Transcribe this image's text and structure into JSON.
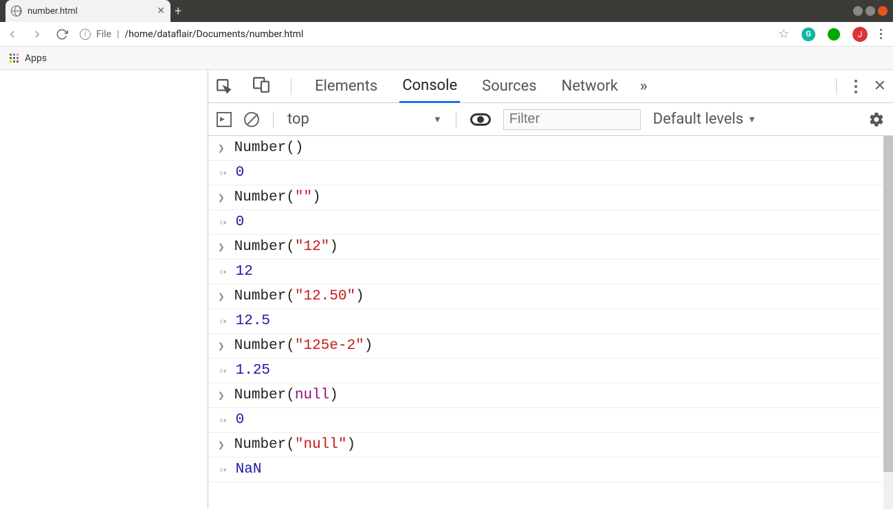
{
  "browser": {
    "tab_title": "number.html",
    "new_tab": "+",
    "addr_file_label": "File",
    "addr_path": "/home/dataflair/Documents/number.html",
    "apps_label": "Apps",
    "ext_g": "G",
    "ext_j": "J"
  },
  "devtools": {
    "tabs": {
      "elements": "Elements",
      "console": "Console",
      "sources": "Sources",
      "network": "Network"
    },
    "more": "»",
    "close": "✕"
  },
  "con_toolbar": {
    "context": "top",
    "filter_placeholder": "Filter",
    "levels": "Default levels"
  },
  "console": [
    {
      "type": "in",
      "tokens": [
        {
          "cls": "fn",
          "t": "Number()"
        }
      ]
    },
    {
      "type": "out",
      "tokens": [
        {
          "cls": "num",
          "t": "0"
        }
      ]
    },
    {
      "type": "in",
      "tokens": [
        {
          "cls": "fn",
          "t": "Number("
        },
        {
          "cls": "str",
          "t": "\"\""
        },
        {
          "cls": "fn",
          "t": ")"
        }
      ]
    },
    {
      "type": "out",
      "tokens": [
        {
          "cls": "num",
          "t": "0"
        }
      ]
    },
    {
      "type": "in",
      "tokens": [
        {
          "cls": "fn",
          "t": "Number("
        },
        {
          "cls": "str",
          "t": "\"12\""
        },
        {
          "cls": "fn",
          "t": ")"
        }
      ]
    },
    {
      "type": "out",
      "tokens": [
        {
          "cls": "num",
          "t": "12"
        }
      ]
    },
    {
      "type": "in",
      "tokens": [
        {
          "cls": "fn",
          "t": "Number("
        },
        {
          "cls": "str",
          "t": "\"12.50\""
        },
        {
          "cls": "fn",
          "t": ")"
        }
      ]
    },
    {
      "type": "out",
      "tokens": [
        {
          "cls": "num",
          "t": "12.5"
        }
      ]
    },
    {
      "type": "in",
      "tokens": [
        {
          "cls": "fn",
          "t": "Number("
        },
        {
          "cls": "str",
          "t": "\"125e-2\""
        },
        {
          "cls": "fn",
          "t": ")"
        }
      ]
    },
    {
      "type": "out",
      "tokens": [
        {
          "cls": "num",
          "t": "1.25"
        }
      ]
    },
    {
      "type": "in",
      "tokens": [
        {
          "cls": "fn",
          "t": "Number("
        },
        {
          "cls": "null",
          "t": "null"
        },
        {
          "cls": "fn",
          "t": ")"
        }
      ]
    },
    {
      "type": "out",
      "tokens": [
        {
          "cls": "num",
          "t": "0"
        }
      ]
    },
    {
      "type": "in",
      "tokens": [
        {
          "cls": "fn",
          "t": "Number("
        },
        {
          "cls": "str",
          "t": "\"null\""
        },
        {
          "cls": "fn",
          "t": ")"
        }
      ]
    },
    {
      "type": "out",
      "tokens": [
        {
          "cls": "num",
          "t": "NaN"
        }
      ]
    }
  ]
}
